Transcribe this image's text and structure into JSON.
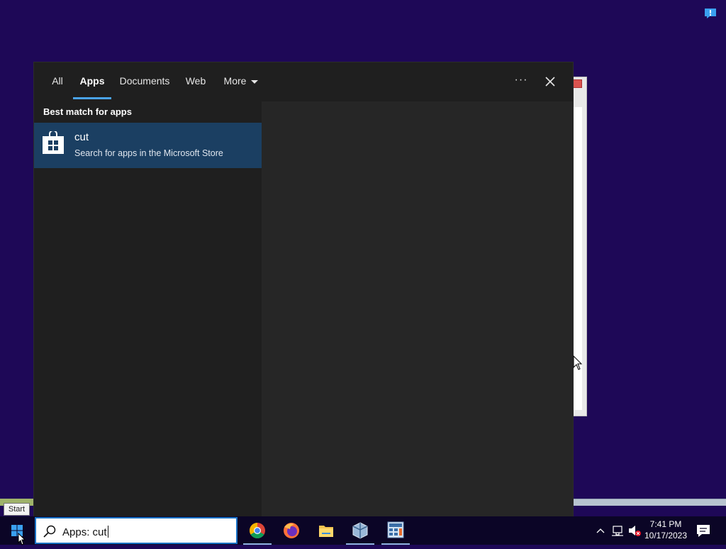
{
  "desktop": {
    "background": "#1e0857",
    "notify_icon": "feedback-icon"
  },
  "search_panel": {
    "tabs": [
      {
        "label": "All"
      },
      {
        "label": "Apps",
        "active": true
      },
      {
        "label": "Documents"
      },
      {
        "label": "Web"
      },
      {
        "label": "More"
      }
    ],
    "more_options_label": "···",
    "close_icon": "close-icon",
    "section_heading": "Best match for apps",
    "best_match": {
      "title": "cut",
      "subtitle": "Search for apps in the Microsoft Store",
      "icon": "microsoft-store-icon"
    }
  },
  "tooltip": {
    "text": "Start"
  },
  "taskbar": {
    "start_icon": "windows-logo-icon",
    "search": {
      "query": "Apps: cut",
      "icon": "search-icon"
    },
    "apps": [
      {
        "name": "chrome-icon"
      },
      {
        "name": "firefox-icon"
      },
      {
        "name": "file-explorer-icon"
      },
      {
        "name": "virtualbox-icon"
      },
      {
        "name": "calculator-icon"
      }
    ],
    "tray": {
      "icons": [
        "chevron-up-icon",
        "network-icon",
        "volume-muted-icon"
      ],
      "time": "7:41 PM",
      "date": "10/17/2023",
      "action_center_icon": "notification-icon"
    }
  },
  "colors": {
    "accent": "#1a73c7",
    "selected_item": "#1b3f62",
    "tab_underline": "#4aa3e8"
  }
}
